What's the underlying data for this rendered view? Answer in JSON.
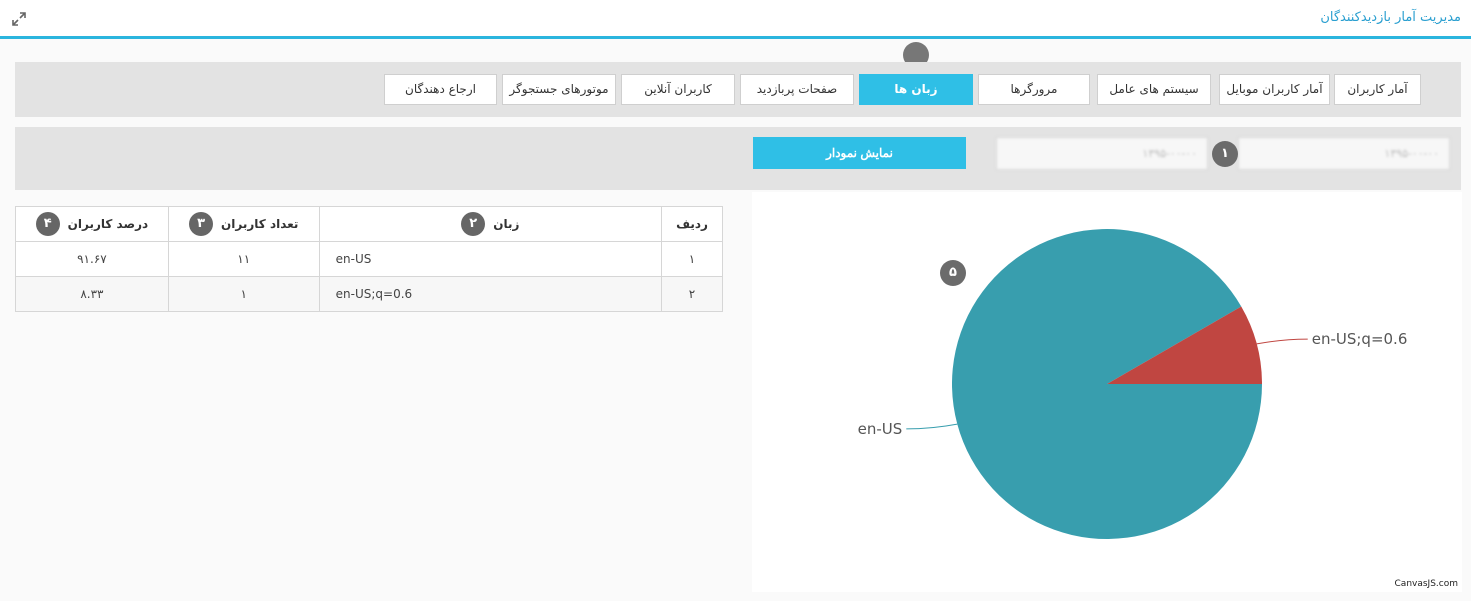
{
  "panel": {
    "title": "مدیریت آمار بازدیدکنندگان",
    "expand_icon": "expand-arrows-icon"
  },
  "tabs": [
    {
      "label": "آمار کاربران",
      "active": false
    },
    {
      "label": "آمار کاربران موبایل",
      "active": false
    },
    {
      "label": "سیستم های عامل",
      "active": false
    },
    {
      "label": "مرورگرها",
      "active": false
    },
    {
      "label": "زبان ها",
      "active": true
    },
    {
      "label": "صفحات پربازدید",
      "active": false
    },
    {
      "label": "کاربران آنلاین",
      "active": false
    },
    {
      "label": "موتورهای جستجوگر",
      "active": false
    },
    {
      "label": "ارجاع دهندگان",
      "active": false
    }
  ],
  "filter": {
    "date_from": "۱۳۹۵-۰۰-۰۰",
    "date_to": "۱۳۹۵-۰۰-۰۰",
    "show_chart_label": "نمایش نمودار"
  },
  "markers": {
    "m1": "۱",
    "m2": "۲",
    "m3": "۳",
    "m4": "۴",
    "m5": "۵"
  },
  "table": {
    "headers": {
      "row": "ردیف",
      "language": "زبان",
      "count": "تعداد کاربران",
      "percent": "درصد کاربران"
    },
    "rows": [
      {
        "row": "۱",
        "language": "en-US",
        "count": "۱۱",
        "percent": "۹۱.۶۷"
      },
      {
        "row": "۲",
        "language": "en-US;q=0.6",
        "count": "۱",
        "percent": "۸.۳۳"
      }
    ]
  },
  "chart_data": {
    "type": "pie",
    "categories": [
      "en-US",
      "en-US;q=0.6"
    ],
    "values": [
      91.67,
      8.33
    ],
    "colors": [
      "#389eae",
      "#c04641"
    ],
    "title": "",
    "credit": "CanvasJS.com"
  },
  "colors": {
    "accent": "#2fbfe6",
    "header_line": "#2bb5de",
    "title": "#2a9fd0"
  }
}
